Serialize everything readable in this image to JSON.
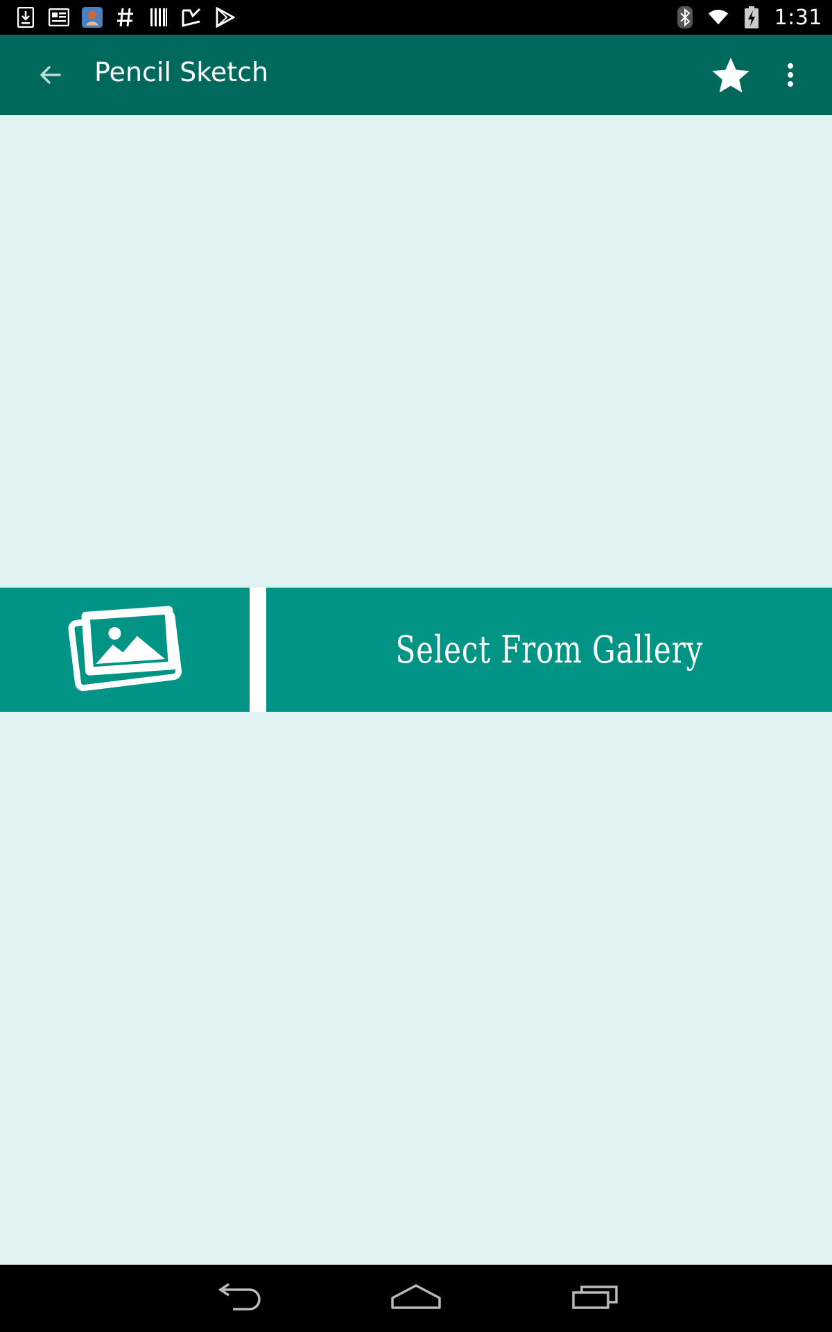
{
  "status_bar": {
    "time": "1:31",
    "left_icons": [
      "download-icon",
      "news-icon",
      "app-avatar-icon",
      "hashtag-icon",
      "barcode-icon",
      "checklist-icon",
      "play-store-icon"
    ],
    "right_icons": [
      "bluetooth-icon",
      "wifi-icon",
      "battery-charging-icon"
    ]
  },
  "app_bar": {
    "title": "Pencil Sketch",
    "back_icon": "arrow-left-icon",
    "favorite_icon": "star-icon",
    "more_icon": "more-vert-icon"
  },
  "gallery": {
    "icon": "photo-gallery-icon",
    "label": "Select From Gallery"
  },
  "nav_bar": {
    "buttons": [
      "back-nav-icon",
      "home-nav-icon",
      "recents-nav-icon"
    ]
  },
  "colors": {
    "app_bar": "#00695c",
    "background": "#e0f3f1",
    "gallery_tile": "#009485"
  }
}
